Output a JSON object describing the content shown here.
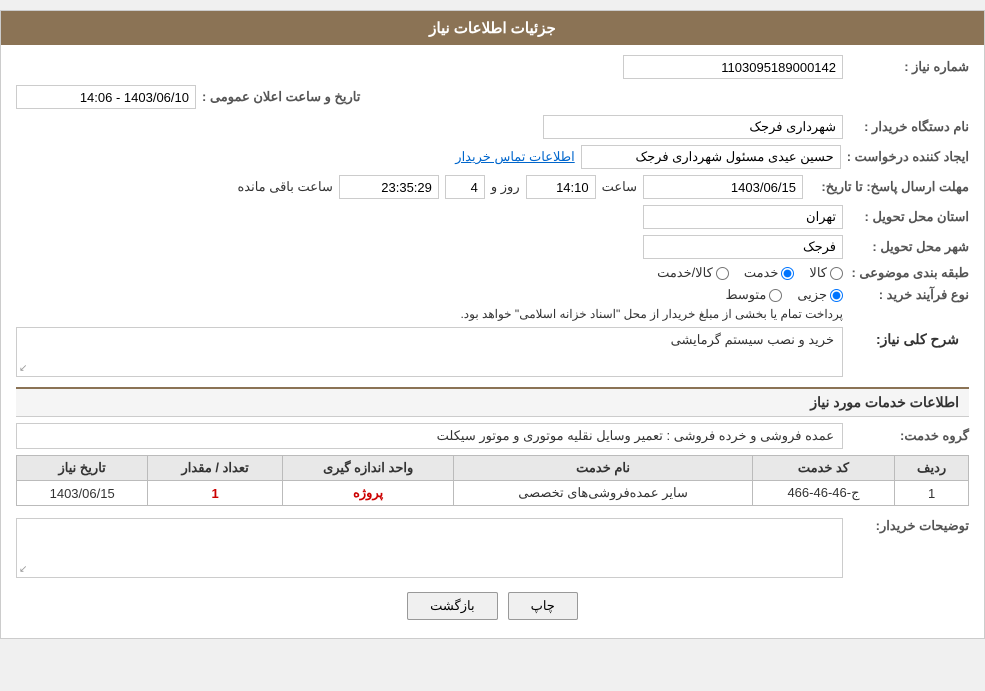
{
  "header": {
    "title": "جزئیات اطلاعات نیاز"
  },
  "form": {
    "shmare_niaz_label": "شماره نیاز :",
    "shmare_niaz_value": "1103095189000142",
    "nam_dastgah_label": "نام دستگاه خریدار :",
    "nam_dastgah_value": "شهرداری فرجک",
    "ijad_konande_label": "ایجاد کننده درخواست :",
    "ijad_konande_value": "حسین عیدی مسئول شهرداری فرجک",
    "ettelaat_tamas_link": "اطلاعات تماس خریدار",
    "mohlat_ersal_label": "مهلت ارسال پاسخ: تا تاریخ:",
    "mohlat_date": "1403/06/15",
    "mohlat_saat_label": "ساعت",
    "mohlat_saat_value": "14:10",
    "mohlat_rooz_label": "روز و",
    "mohlat_rooz_value": "4",
    "mohlat_saat_mande_label": "ساعت باقی مانده",
    "mohlat_saat_mande_value": "23:35:29",
    "ostan_label": "استان محل تحویل :",
    "ostan_value": "تهران",
    "shahr_label": "شهر محل تحویل :",
    "shahr_value": "فرجک",
    "tabeeh_label": "طبقه بندی موضوعی :",
    "tabeeh_options": [
      {
        "label": "کالا",
        "value": "kala"
      },
      {
        "label": "خدمت",
        "value": "khedmat"
      },
      {
        "label": "کالا/خدمت",
        "value": "kala_khedmat"
      }
    ],
    "tabeeh_selected": "khedmat",
    "farvanad_label": "نوع فرآیند خرید :",
    "farvanad_options": [
      {
        "label": "جزیی",
        "value": "jozi"
      },
      {
        "label": "متوسط",
        "value": "motavaset"
      }
    ],
    "farvanad_selected": "jozi",
    "farvanad_note": "پرداخت تمام یا بخشی از مبلغ خریدار از محل \"اسناد خزانه اسلامی\" خواهد بود.",
    "tarikh_va_saat_label": "تاریخ و ساعت اعلان عمومی :",
    "tarikh_va_saat_value": "1403/06/10 - 14:06"
  },
  "sharh": {
    "section_title": "شرح کلی نیاز:",
    "text": "خرید و نصب سیستم گرمایشی"
  },
  "khadamat": {
    "section_title": "اطلاعات خدمات مورد نیاز",
    "goroh_label": "گروه خدمت:",
    "goroh_value": "عمده فروشی و خرده فروشی : تعمیر وسایل نقلیه موتوری و موتور سیکلت",
    "table": {
      "headers": [
        "ردیف",
        "کد خدمت",
        "نام خدمت",
        "واحد اندازه گیری",
        "تعداد / مقدار",
        "تاریخ نیاز"
      ],
      "rows": [
        {
          "radif": "1",
          "kod": "ج-46-46-466",
          "nam": "سایر عمده‌فروشی‌های تخصصی",
          "vahed": "پروژه",
          "tedad": "1",
          "tarikh": "1403/06/15"
        }
      ]
    }
  },
  "toz": {
    "label": "توضیحات خریدار:",
    "text": ""
  },
  "buttons": {
    "chap_label": "چاپ",
    "bazgasht_label": "بازگشت"
  }
}
